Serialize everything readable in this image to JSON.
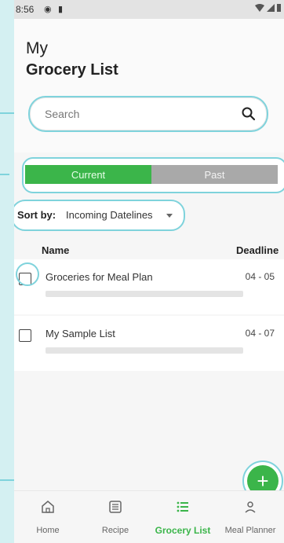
{
  "status_bar": {
    "time": "8:56"
  },
  "header": {
    "title_line1": "My",
    "title_line2": "Grocery List"
  },
  "search": {
    "placeholder": "Search"
  },
  "segments": {
    "current": "Current",
    "past": "Past"
  },
  "sort": {
    "label": "Sort by:",
    "value": "Incoming Datelines"
  },
  "columns": {
    "name": "Name",
    "deadline": "Deadline"
  },
  "lists": [
    {
      "name": "Groceries for Meal Plan",
      "deadline": "04 - 05"
    },
    {
      "name": "My Sample List",
      "deadline": "04 - 07"
    }
  ],
  "fab": {
    "symbol": "+"
  },
  "bottom_nav": [
    {
      "label": "Home",
      "icon": "home-icon"
    },
    {
      "label": "Recipe",
      "icon": "recipe-icon"
    },
    {
      "label": "Grocery List",
      "icon": "list-icon",
      "active": true
    },
    {
      "label": "Meal Planner",
      "icon": "person-icon"
    }
  ],
  "colors": {
    "accent": "#3bb54a",
    "highlight": "#7fd3dc",
    "background": "#d4f0f2"
  }
}
